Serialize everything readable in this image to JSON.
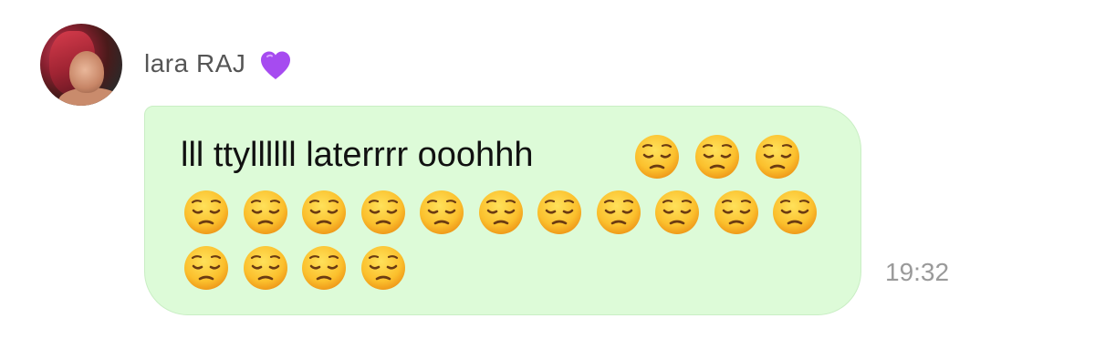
{
  "message": {
    "sender_name": "lara RAJ",
    "sender_badge_icon": "purple-heart-icon",
    "text": "lll ttyllllll laterrrr ooohhh",
    "emoji_icon": "pensive-face-icon",
    "emoji_count": 18,
    "timestamp": "19:32",
    "bubble_color": "#ddfbd8",
    "bubble_border_color": "#c9eec4",
    "heart_color": "#a64bf0"
  }
}
